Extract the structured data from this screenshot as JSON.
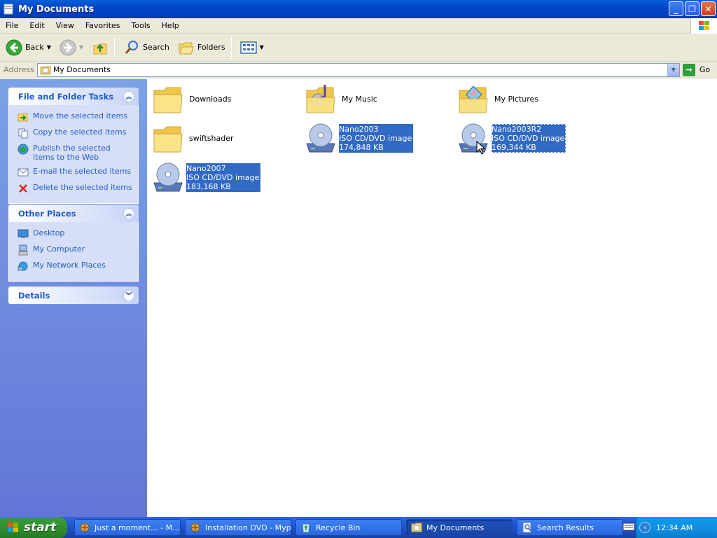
{
  "window": {
    "title": "My Documents",
    "buttons": {
      "minimize": "_",
      "maximize": "❐",
      "close": "✕"
    }
  },
  "menu": [
    "File",
    "Edit",
    "View",
    "Favorites",
    "Tools",
    "Help"
  ],
  "toolbar": {
    "back": "Back",
    "search": "Search",
    "folders": "Folders"
  },
  "address": {
    "label": "Address",
    "value": "My Documents",
    "go": "Go"
  },
  "tasks_panel": {
    "title": "File and Folder Tasks",
    "items": [
      {
        "label": "Move the selected items",
        "icon": "move-icon"
      },
      {
        "label": "Copy the selected items",
        "icon": "copy-icon"
      },
      {
        "label": "Publish the selected items to the Web",
        "icon": "web-publish-icon"
      },
      {
        "label": "E-mail the selected items",
        "icon": "email-icon"
      },
      {
        "label": "Delete the selected items",
        "icon": "delete-icon"
      }
    ]
  },
  "places_panel": {
    "title": "Other Places",
    "items": [
      {
        "label": "Desktop",
        "icon": "desktop-icon"
      },
      {
        "label": "My Computer",
        "icon": "my-computer-icon"
      },
      {
        "label": "My Network Places",
        "icon": "network-places-icon"
      }
    ]
  },
  "details_panel": {
    "title": "Details"
  },
  "files": [
    {
      "name": "Downloads",
      "type": "folder"
    },
    {
      "name": "My Music",
      "type": "music-folder"
    },
    {
      "name": "My Pictures",
      "type": "pictures-folder"
    },
    {
      "name": "swiftshader",
      "type": "folder"
    },
    {
      "name": "Nano2003",
      "type": "iso",
      "desc": "ISO CD/DVD image",
      "size": "174,848 KB",
      "selected": true
    },
    {
      "name": "Nano2003R2",
      "type": "iso",
      "desc": "ISO CD/DVD image",
      "size": "169,344 KB",
      "selected": true
    },
    {
      "name": "Nano2007",
      "type": "iso",
      "desc": "ISO CD/DVD image",
      "size": "183,168 KB",
      "selected": true
    }
  ],
  "taskbar": {
    "start": "start",
    "items": [
      {
        "label": "Just a moment... - M...",
        "icon": "browser-icon"
      },
      {
        "label": "Installation DVD - Mypal",
        "icon": "browser-icon"
      },
      {
        "label": "Recycle Bin",
        "icon": "recycle-bin-icon"
      },
      {
        "label": "My Documents",
        "icon": "folder-icon",
        "active": true
      },
      {
        "label": "Search Results",
        "icon": "search-results-icon"
      }
    ],
    "clock": "12:34 AM"
  },
  "colors": {
    "titlebar": "#0046c8",
    "selection": "#316ac5",
    "panel_link": "#215dc6",
    "left_pane": "#6f8ddf"
  }
}
